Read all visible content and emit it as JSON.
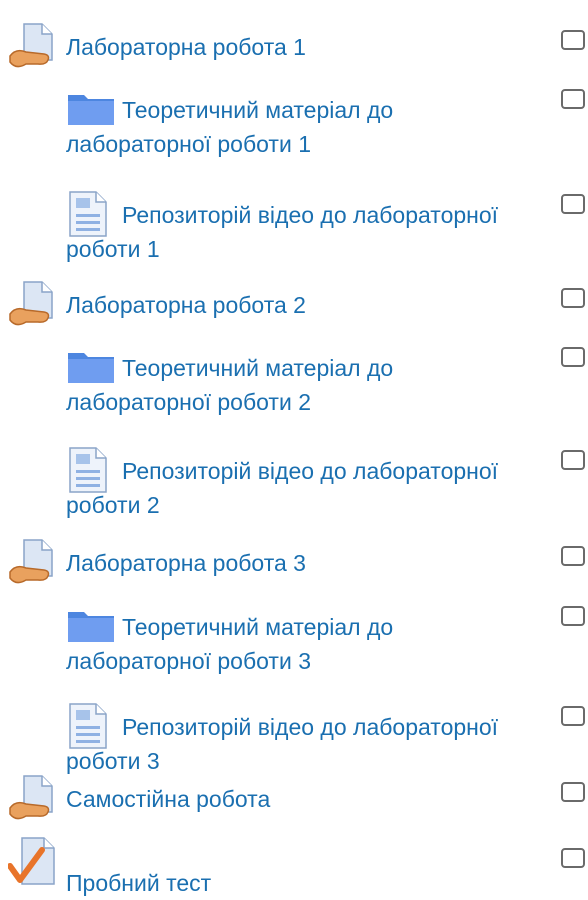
{
  "activities": [
    {
      "type": "assignment",
      "icon": "assignment-icon",
      "text": "Лабораторна робота 1"
    },
    {
      "type": "folder",
      "icon": "folder-icon",
      "text_line1": "Теоретичний матеріал до",
      "text_line2": "лабораторної роботи 1"
    },
    {
      "type": "page",
      "icon": "page-icon",
      "text_line1": "Репозиторій відео до лабораторної",
      "text_line2": "роботи 1"
    },
    {
      "type": "assignment",
      "icon": "assignment-icon",
      "text": "Лабораторна робота 2"
    },
    {
      "type": "folder",
      "icon": "folder-icon",
      "text_line1": "Теоретичний матеріал до",
      "text_line2": "лабораторної роботи 2"
    },
    {
      "type": "page",
      "icon": "page-icon",
      "text_line1": "Репозиторій відео до лабораторної",
      "text_line2": "роботи 2"
    },
    {
      "type": "assignment",
      "icon": "assignment-icon",
      "text": "Лабораторна робота 3"
    },
    {
      "type": "folder",
      "icon": "folder-icon",
      "text_line1": "Теоретичний матеріал до",
      "text_line2": "лабораторної роботи 3"
    },
    {
      "type": "page",
      "icon": "page-icon",
      "text_line1": "Репозиторій відео до лабораторної",
      "text_line2": "роботи 3"
    },
    {
      "type": "assignment",
      "icon": "assignment-icon",
      "text": "Самостійна робота"
    },
    {
      "type": "quiz",
      "icon": "quiz-icon",
      "text": "Пробний тест"
    }
  ],
  "colors": {
    "link": "#1a6fb0",
    "checkbox_border": "#6a6a6a"
  }
}
